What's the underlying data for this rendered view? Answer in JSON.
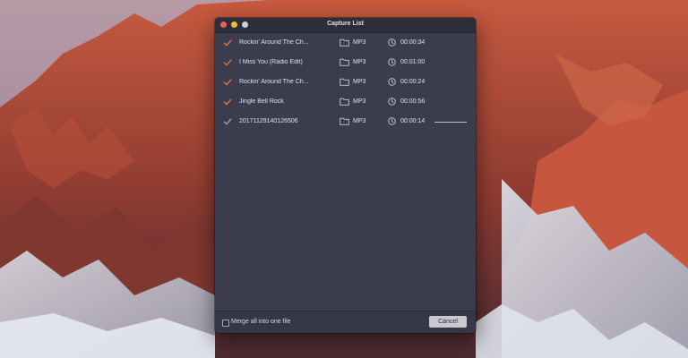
{
  "window": {
    "title": "Capture List"
  },
  "captures": [
    {
      "name": "Rockin' Around The Ch...",
      "checked": true,
      "format": "MP3",
      "duration": "00:00:34"
    },
    {
      "name": "I Miss You (Radio Edit)",
      "checked": true,
      "format": "MP3",
      "duration": "00:01:00"
    },
    {
      "name": "Rockin' Around The Ch...",
      "checked": true,
      "format": "MP3",
      "duration": "00:00:24"
    },
    {
      "name": "Jingle Bell Rock",
      "checked": true,
      "format": "MP3",
      "duration": "00:00:56"
    },
    {
      "name": "20171129140126506",
      "checked": true,
      "format": "MP3",
      "duration": "00:00:14",
      "progress": 1.0
    }
  ],
  "footer": {
    "merge_label": "Merge all into one file",
    "merge_checked": false,
    "cancel_label": "Cancel"
  },
  "colors": {
    "check_active": "#e8733f",
    "check_pending": "#9ea0ab"
  }
}
